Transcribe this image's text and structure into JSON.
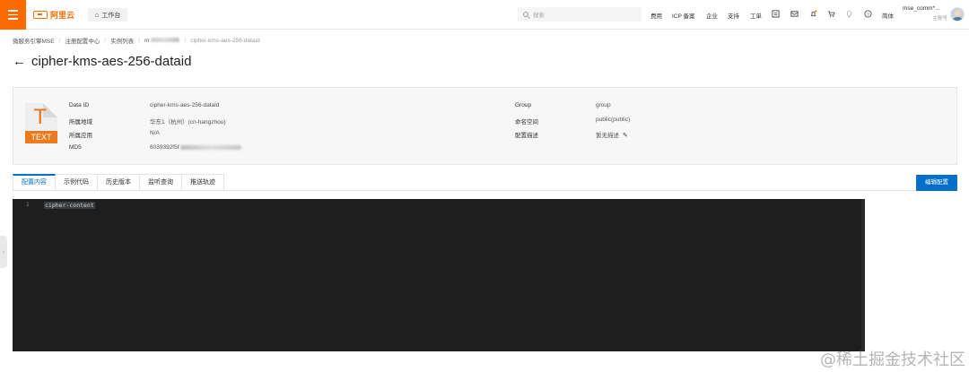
{
  "topbar": {
    "logo_text": "阿里云",
    "workbench_label": "工作台",
    "search_placeholder": "搜索",
    "links": [
      "费用",
      "ICP 备案",
      "企业",
      "支持",
      "工单"
    ],
    "language": "简体",
    "account_name": "mse_comm*...",
    "account_role": "主账号",
    "accent_color": "#ff6a00"
  },
  "breadcrumb": {
    "items": [
      "微服务引擎MSE",
      "注册配置中心",
      "实例列表",
      "m",
      "cipher-kms-aes-256-dataid"
    ]
  },
  "page": {
    "title": "cipher-kms-aes-256-dataid"
  },
  "info": {
    "file_badge_letter": "T",
    "file_badge_tag": "TEXT",
    "fields_left": [
      {
        "label": "Data ID",
        "value": "cipher-kms-aes-256-dataid"
      },
      {
        "label": "所属地域",
        "value": "华东1（杭州）(cn-hangzhou)"
      },
      {
        "label": "所属应用",
        "value": "N/A"
      },
      {
        "label": "MD5",
        "value": "6039392f5f"
      }
    ],
    "fields_right": [
      {
        "label": "Group",
        "value": "group"
      },
      {
        "label": "命名空间",
        "value": "public(public)"
      },
      {
        "label": "配置描述",
        "value": "暂无描述"
      }
    ]
  },
  "tabs": [
    "配置内容",
    "示例代码",
    "历史版本",
    "监听查询",
    "推送轨迹"
  ],
  "active_tab": "配置内容",
  "edit_button_label": "编辑配置",
  "editor": {
    "line_number": "1",
    "content": "cipher-content"
  },
  "watermark": "@稀土掘金技术社区"
}
